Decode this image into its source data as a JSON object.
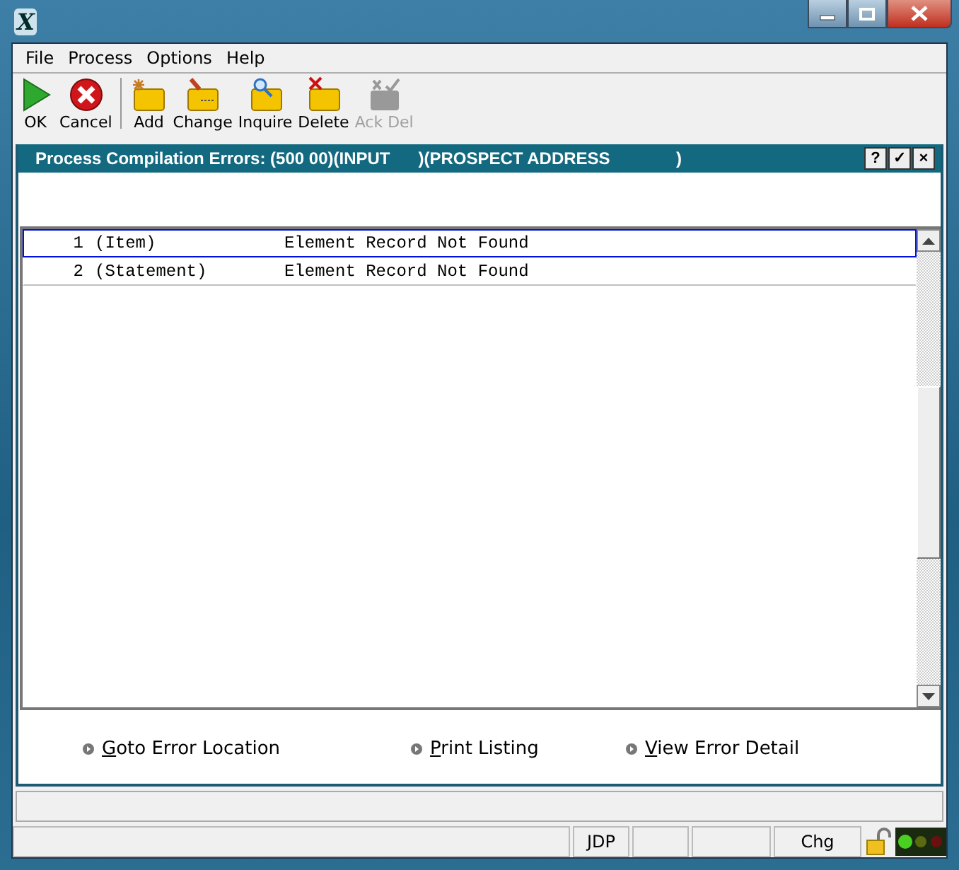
{
  "window": {
    "app_icon": "X"
  },
  "menu": [
    "File",
    "Process",
    "Options",
    "Help"
  ],
  "toolbar": [
    {
      "label": "OK",
      "kind": "ok",
      "disabled": false
    },
    {
      "label": "Cancel",
      "kind": "cancel",
      "disabled": false
    },
    {
      "label": "Add",
      "kind": "add",
      "disabled": false
    },
    {
      "label": "Change",
      "kind": "change",
      "disabled": false
    },
    {
      "label": "Inquire",
      "kind": "inquire",
      "disabled": false
    },
    {
      "label": "Delete",
      "kind": "delete",
      "disabled": false
    },
    {
      "label": "Ack Del",
      "kind": "ackdel",
      "disabled": true
    }
  ],
  "panel": {
    "title": "Process Compilation Errors: (500 00)(INPUT      )(PROSPECT ADDRESS              )",
    "buttons": [
      "?",
      "✓",
      "×"
    ]
  },
  "errors": [
    {
      "number": "1",
      "type": "(Item)",
      "message": "Element Record Not Found",
      "selected": true
    },
    {
      "number": "2",
      "type": "(Statement)",
      "message": "Element Record Not Found",
      "selected": false
    }
  ],
  "links": [
    "Goto Error Location",
    "Print Listing",
    "View Error Detail"
  ],
  "status_bar": [
    "JDP",
    "Chg"
  ]
}
